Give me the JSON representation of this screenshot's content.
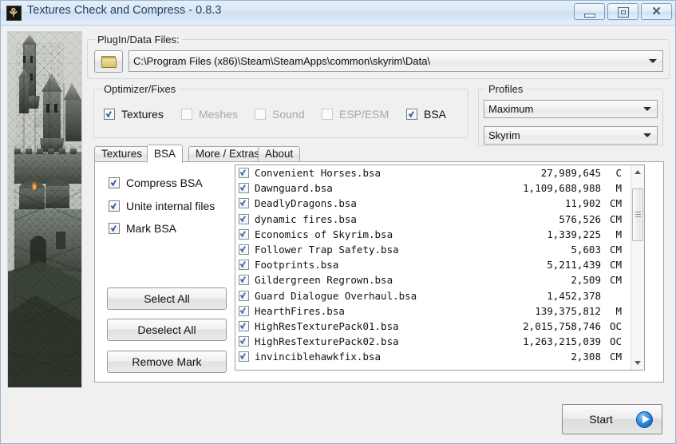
{
  "window": {
    "title": "Textures Check and Compress - 0.8.3",
    "icon": "app-emblem-icon",
    "minimize_label": "",
    "maximize_label": "",
    "close_label": "✕"
  },
  "plugin_group": {
    "legend": "PlugIn/Data Files:",
    "browse_icon": "folder-icon",
    "path_value": "C:\\Program Files (x86)\\Steam\\SteamApps\\common\\skyrim\\Data\\"
  },
  "optimizer_group": {
    "legend": "Optimizer/Fixes",
    "items": [
      {
        "label": "Textures",
        "checked": true,
        "enabled": true
      },
      {
        "label": "Meshes",
        "checked": false,
        "enabled": false
      },
      {
        "label": "Sound",
        "checked": false,
        "enabled": false
      },
      {
        "label": "ESP/ESM",
        "checked": false,
        "enabled": false
      },
      {
        "label": "BSA",
        "checked": true,
        "enabled": true
      }
    ]
  },
  "profiles_group": {
    "legend": "Profiles",
    "quality_value": "Maximum",
    "game_value": "Skyrim"
  },
  "tabs": [
    {
      "label": "Textures",
      "active": false
    },
    {
      "label": "BSA",
      "active": true
    },
    {
      "label": "More / Extras",
      "active": false
    },
    {
      "label": "About",
      "active": false
    }
  ],
  "bsa_panel": {
    "options": [
      {
        "label": "Compress BSA",
        "checked": true
      },
      {
        "label": "Unite internal files",
        "checked": true
      },
      {
        "label": "Mark BSA",
        "checked": true
      }
    ],
    "buttons": {
      "select_all": "Select All",
      "deselect_all": "Deselect All",
      "remove_mark": "Remove Mark"
    },
    "files": [
      {
        "name": "Convenient Horses.bsa",
        "size": "27,989,645",
        "flags": "C",
        "checked": true
      },
      {
        "name": "Dawnguard.bsa",
        "size": "1,109,688,988",
        "flags": "M",
        "checked": true
      },
      {
        "name": "DeadlyDragons.bsa",
        "size": "11,902",
        "flags": "CM",
        "checked": true
      },
      {
        "name": "dynamic fires.bsa",
        "size": "576,526",
        "flags": "CM",
        "checked": true
      },
      {
        "name": "Economics of Skyrim.bsa",
        "size": "1,339,225",
        "flags": "M",
        "checked": true
      },
      {
        "name": "Follower Trap Safety.bsa",
        "size": "5,603",
        "flags": "CM",
        "checked": true
      },
      {
        "name": "Footprints.bsa",
        "size": "5,211,439",
        "flags": "CM",
        "checked": true
      },
      {
        "name": "Gildergreen Regrown.bsa",
        "size": "2,509",
        "flags": "CM",
        "checked": true
      },
      {
        "name": "Guard Dialogue Overhaul.bsa",
        "size": "1,452,378",
        "flags": "",
        "checked": true
      },
      {
        "name": "HearthFires.bsa",
        "size": "139,375,812",
        "flags": "M",
        "checked": true
      },
      {
        "name": "HighResTexturePack01.bsa",
        "size": "2,015,758,746",
        "flags": "OC",
        "checked": true
      },
      {
        "name": "HighResTexturePack02.bsa",
        "size": "1,263,215,039",
        "flags": "OC",
        "checked": true
      },
      {
        "name": "invinciblehawkfix.bsa",
        "size": "2,308",
        "flags": "CM",
        "checked": true
      }
    ]
  },
  "footer": {
    "start_label": "Start",
    "start_icon": "play-circle-icon"
  },
  "colors": {
    "titlebar_text": "#26435b",
    "accent_blue": "#2a86df",
    "check_blue": "#3a5fa0",
    "disabled_text": "#a8a8a8"
  }
}
